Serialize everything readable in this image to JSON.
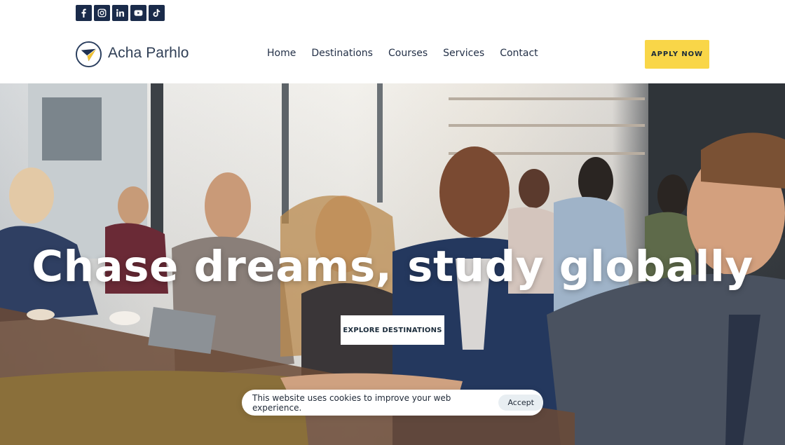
{
  "brand": {
    "name": "Acha Parhlo",
    "accent": "#f9d648",
    "navy": "#1a2b4a"
  },
  "socials": [
    {
      "icon": "facebook-icon"
    },
    {
      "icon": "instagram-icon"
    },
    {
      "icon": "linkedin-icon"
    },
    {
      "icon": "youtube-icon"
    },
    {
      "icon": "tiktok-icon"
    }
  ],
  "nav": {
    "items": [
      "Home",
      "Destinations",
      "Courses",
      "Services",
      "Contact"
    ],
    "cta": "APPLY NOW"
  },
  "hero": {
    "title": "Chase dreams, study globally",
    "button": "EXPLORE DESTINATIONS"
  },
  "cookie": {
    "message": "This website uses cookies to improve your web experience.",
    "accept": "Accept"
  }
}
